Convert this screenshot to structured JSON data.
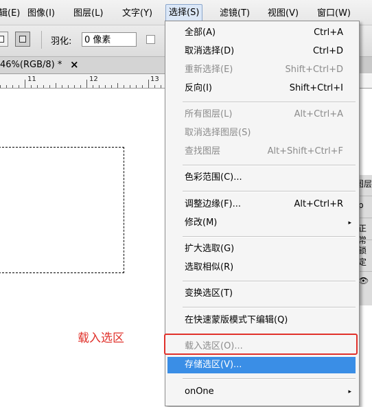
{
  "menubar": {
    "items": [
      {
        "label": "辑(E)"
      },
      {
        "label": "图像(I)"
      },
      {
        "label": "图层(L)"
      },
      {
        "label": "文字(Y)"
      },
      {
        "label": "选择(S)"
      },
      {
        "label": "滤镜(T)"
      },
      {
        "label": "视图(V)"
      },
      {
        "label": "窗口(W)"
      }
    ]
  },
  "options": {
    "feather_label": "羽化:",
    "feather_value": "0 像素"
  },
  "document": {
    "tab_title": "46%(RGB/8) *",
    "close": "×"
  },
  "ruler": {
    "labels": [
      "11",
      "12",
      "13"
    ]
  },
  "panel": {
    "tab": "图层",
    "row1": "ρ",
    "row2": "正常",
    "row3": "锁定",
    "row4": "👁"
  },
  "dropdown": {
    "items": [
      {
        "label": "全部(A)",
        "shortcut": "Ctrl+A",
        "enabled": true
      },
      {
        "label": "取消选择(D)",
        "shortcut": "Ctrl+D",
        "enabled": true
      },
      {
        "label": "重新选择(E)",
        "shortcut": "Shift+Ctrl+D",
        "enabled": false
      },
      {
        "label": "反向(I)",
        "shortcut": "Shift+Ctrl+I",
        "enabled": true
      },
      {
        "label": "所有图层(L)",
        "shortcut": "Alt+Ctrl+A",
        "enabled": false
      },
      {
        "label": "取消选择图层(S)",
        "shortcut": "",
        "enabled": false
      },
      {
        "label": "查找图层",
        "shortcut": "Alt+Shift+Ctrl+F",
        "enabled": false
      },
      {
        "label": "色彩范围(C)...",
        "shortcut": "",
        "enabled": true
      },
      {
        "label": "调整边缘(F)...",
        "shortcut": "Alt+Ctrl+R",
        "enabled": true
      },
      {
        "label": "修改(M)",
        "shortcut": "",
        "enabled": true,
        "submenu": true
      },
      {
        "label": "扩大选取(G)",
        "shortcut": "",
        "enabled": true
      },
      {
        "label": "选取相似(R)",
        "shortcut": "",
        "enabled": true
      },
      {
        "label": "变换选区(T)",
        "shortcut": "",
        "enabled": true
      },
      {
        "label": "在快速蒙版模式下编辑(Q)",
        "shortcut": "",
        "enabled": true
      },
      {
        "label": "载入选区(O)...",
        "shortcut": "",
        "enabled": false
      },
      {
        "label": "存储选区(V)...",
        "shortcut": "",
        "enabled": true,
        "highlighted": true
      },
      {
        "label": "onOne",
        "shortcut": "",
        "enabled": true,
        "submenu": true
      }
    ],
    "submenu_arrow": "▸"
  },
  "annotation": {
    "text": "载入选区",
    "color": "#e0302a"
  },
  "colors": {
    "highlight": "#3a8ee6",
    "annotation": "#e0302a"
  }
}
